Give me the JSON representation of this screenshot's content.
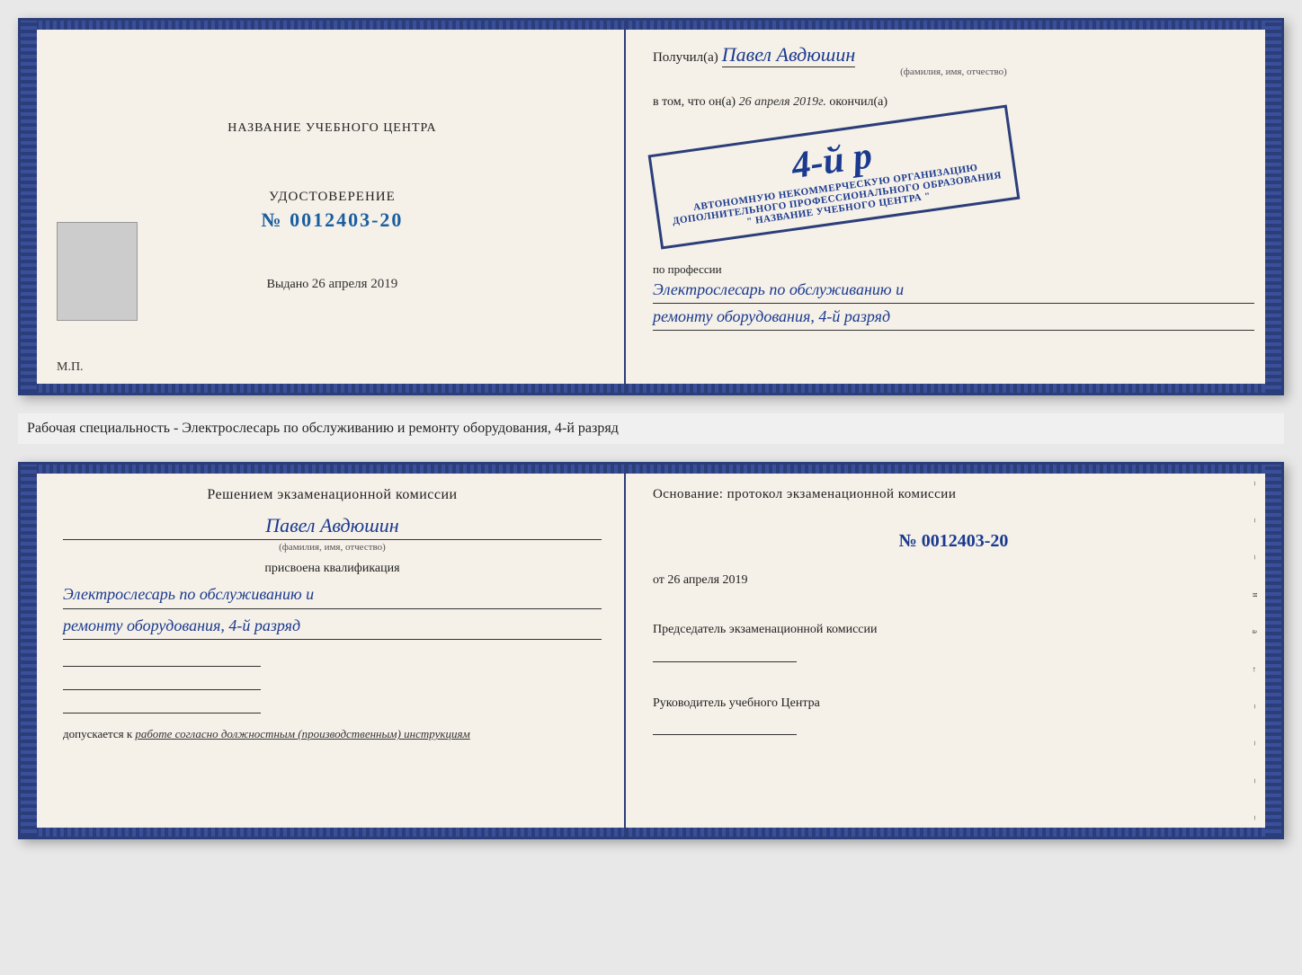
{
  "page": {
    "background": "#e8e8e8"
  },
  "top_booklet": {
    "left": {
      "title": "НАЗВАНИЕ УЧЕБНОГО ЦЕНТРА",
      "photo_alt": "фото",
      "cert_label": "УДОСТОВЕРЕНИЕ",
      "cert_number_prefix": "№",
      "cert_number": "0012403-20",
      "issued_label": "Выдано",
      "issued_date": "26 апреля 2019",
      "mp_label": "М.П."
    },
    "right": {
      "received_prefix": "Получил(а)",
      "received_name": "Павел Авдюшин",
      "name_subtitle": "(фамилия, имя, отчество)",
      "in_that_prefix": "в том, что он(а)",
      "in_that_date": "26 апреля 2019г.",
      "finished_label": "окончил(а)",
      "grade_number": "4-й р",
      "stamp_line1": "АВТОНОМНУЮ НЕКОММЕРЧЕСКУЮ ОРГАНИЗАЦИЮ",
      "stamp_line2": "ДОПОЛНИТЕЛЬНОГО ПРОФЕССИОНАЛЬНОГО ОБРАЗОВАНИЯ",
      "stamp_line3": "\" НАЗВАНИЕ УЧЕБНОГО ЦЕНТРА \"",
      "profession_label": "по профессии",
      "profession_line1": "Электрослесарь по обслуживанию и",
      "profession_line2": "ремонту оборудования, 4-й разряд"
    }
  },
  "separator": {
    "text": "Рабочая специальность - Электрослесарь по обслуживанию и ремонту оборудования, 4-й разряд"
  },
  "bottom_booklet": {
    "left": {
      "commission_title": "Решением экзаменационной комиссии",
      "person_name": "Павел Авдюшин",
      "name_subtitle": "(фамилия, имя, отчество)",
      "assigned_text": "присвоена квалификация",
      "qualification_line1": "Электрослесарь по обслуживанию и",
      "qualification_line2": "ремонту оборудования, 4-й разряд",
      "allowed_prefix": "допускается к",
      "allowed_text": "работе согласно должностным (производственным) инструкциям"
    },
    "right": {
      "basis_title": "Основание: протокол экзаменационной комиссии",
      "protocol_prefix": "№",
      "protocol_number": "0012403-20",
      "from_prefix": "от",
      "from_date": "26 апреля 2019",
      "chairman_label": "Председатель экзаменационной комиссии",
      "director_label": "Руководитель учебного Центра"
    }
  },
  "right_annotations": [
    "–",
    "–",
    "–",
    "и",
    "а",
    "←",
    "–",
    "–",
    "–",
    "–"
  ]
}
